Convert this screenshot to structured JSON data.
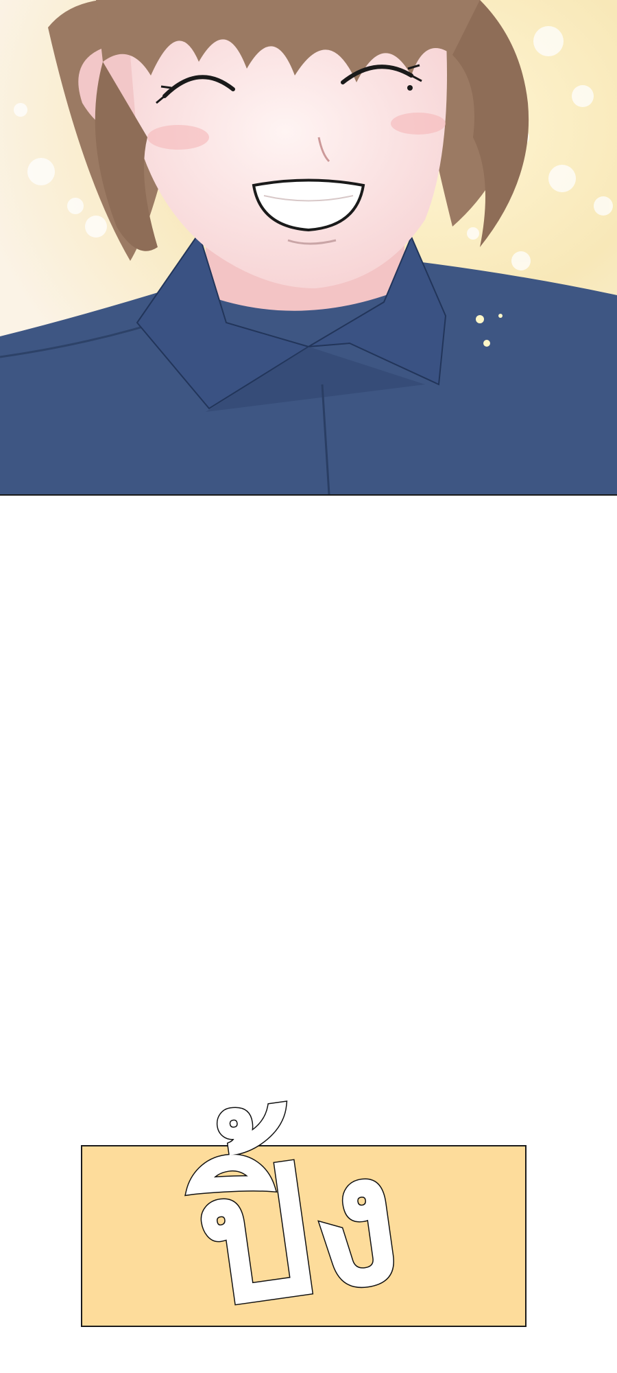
{
  "panels": {
    "top": {
      "character": "smiling-boy",
      "colors": {
        "hair": "#9b7a63",
        "skin": "#fbe3e2",
        "shirt": "#3e5683",
        "background_glow": "#fbf0c8"
      }
    },
    "sfx": {
      "text": "ปิ้ง",
      "box_color": "#fddc9b"
    }
  }
}
